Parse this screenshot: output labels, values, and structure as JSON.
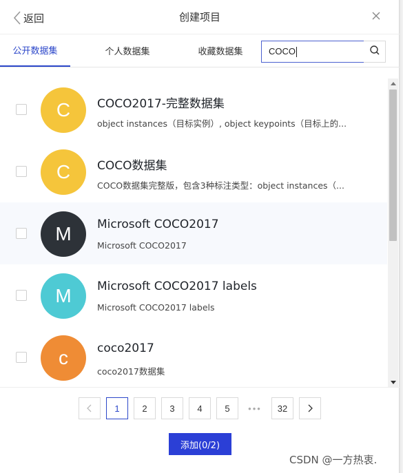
{
  "header": {
    "back_label": "返回",
    "title": "创建项目"
  },
  "tabs": [
    {
      "label": "公开数据集",
      "active": true
    },
    {
      "label": "个人数据集",
      "active": false
    },
    {
      "label": "收藏数据集",
      "active": false
    }
  ],
  "search": {
    "value": "COCO"
  },
  "datasets": [
    {
      "avatar_letter": "C",
      "avatar_color": "#f5c53b",
      "title": "COCO2017-完整数据集",
      "desc": "object instances（目标实例）, object keypoints（目标上的..."
    },
    {
      "avatar_letter": "C",
      "avatar_color": "#f5c53b",
      "title": "COCO数据集",
      "desc": "COCO数据集完整版，包含3种标注类型：object instances（..."
    },
    {
      "avatar_letter": "M",
      "avatar_color": "#2d3238",
      "title": "Microsoft COCO2017",
      "desc": "Microsoft COCO2017"
    },
    {
      "avatar_letter": "M",
      "avatar_color": "#4ecad4",
      "title": "Microsoft COCO2017 labels",
      "desc": "Microsoft COCO2017 labels"
    },
    {
      "avatar_letter": "c",
      "avatar_color": "#ef8c35",
      "title": "coco2017",
      "desc": "coco2017数据集"
    }
  ],
  "pagination": {
    "pages": [
      "1",
      "2",
      "3",
      "4",
      "5"
    ],
    "ellipsis": "•••",
    "last": "32",
    "current": "1"
  },
  "footer": {
    "add_label": "添加(0/2)"
  },
  "watermark": "CSDN @一方热衷."
}
